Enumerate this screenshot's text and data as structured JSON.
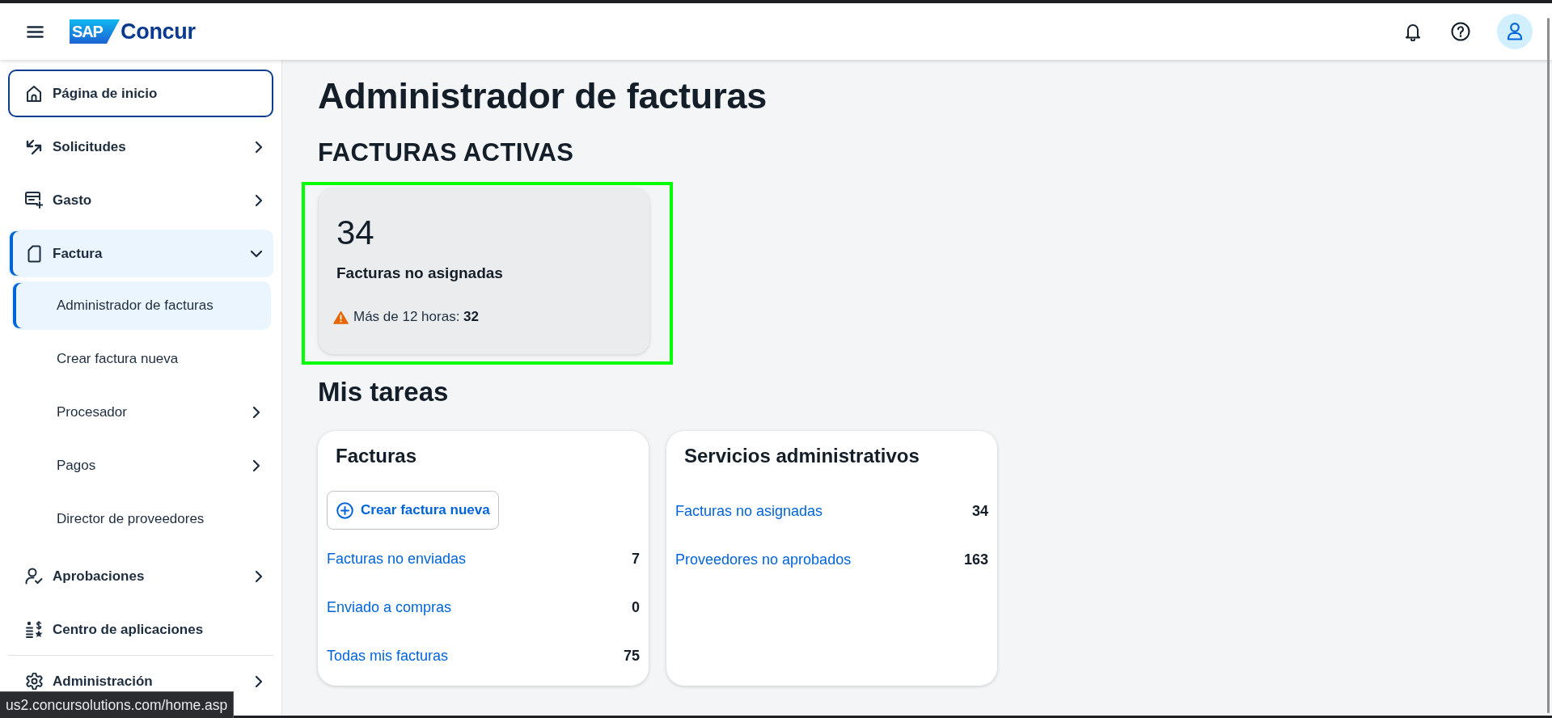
{
  "header": {
    "brand_mark": "SAP",
    "product": "Concur"
  },
  "sidebar": {
    "items": [
      {
        "label": "Página de inicio",
        "selected": false,
        "focused": true
      },
      {
        "label": "Solicitudes",
        "selected": false,
        "focused": false,
        "expanded": false
      },
      {
        "label": "Gasto",
        "selected": false,
        "focused": false,
        "expanded": false
      },
      {
        "label": "Factura",
        "selected": true,
        "focused": false,
        "expanded": true,
        "children": [
          {
            "label": "Administrador de facturas",
            "selected": true
          },
          {
            "label": "Crear factura nueva",
            "selected": false
          },
          {
            "label": "Procesador",
            "selected": false,
            "expanded": false
          },
          {
            "label": "Pagos",
            "selected": false,
            "expanded": false
          },
          {
            "label": "Director de proveedores",
            "selected": false
          }
        ]
      },
      {
        "label": "Aprobaciones",
        "selected": false,
        "focused": false,
        "expanded": false
      },
      {
        "label": "Centro de aplicaciones",
        "selected": false,
        "focused": false
      }
    ],
    "footer_items": [
      {
        "label": "Administración",
        "selected": false,
        "focused": false,
        "expanded": false
      }
    ]
  },
  "page_title": "Administrador de facturas",
  "active_section": {
    "title": "FACTURAS ACTIVAS",
    "highlighted": true,
    "card": {
      "count": "34",
      "label": "Facturas no asignadas",
      "warning": "Más de 12 horas: **32**"
    }
  },
  "tasks": {
    "title": "Mis tareas",
    "cards": [
      {
        "title": "Facturas",
        "action": "Crear factura nueva",
        "rows": [
          {
            "label": "Facturas no enviadas",
            "count": "7"
          },
          {
            "label": "Enviado a compras",
            "count": "0"
          },
          {
            "label": "Todas mis facturas",
            "count": "75"
          }
        ]
      },
      {
        "title": "Servicios administrativos",
        "rows": [
          {
            "label": "Facturas no asignadas",
            "count": "34"
          },
          {
            "label": "Proveedores no aprobados",
            "count": "163"
          }
        ]
      }
    ]
  },
  "status_url": "us2.concursolutions.com/home.asp"
}
